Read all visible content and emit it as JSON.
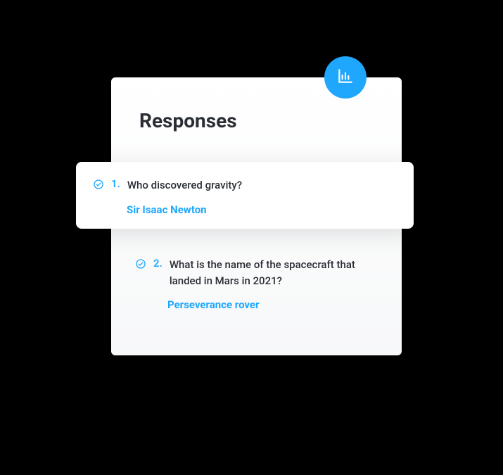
{
  "header": {
    "title": "Responses"
  },
  "items": [
    {
      "number": "1.",
      "question": "Who discovered gravity?",
      "answer": "Sir Isaac Newton"
    },
    {
      "number": "2.",
      "question": "What is the name of the spacecraft that landed in Mars in 2021?",
      "answer": "Perseverance rover"
    }
  ],
  "icons": {
    "analytics": "bar-chart-icon",
    "check": "check-circle-icon"
  },
  "colors": {
    "accent": "#1ea7fd",
    "text": "#2a2e34"
  }
}
